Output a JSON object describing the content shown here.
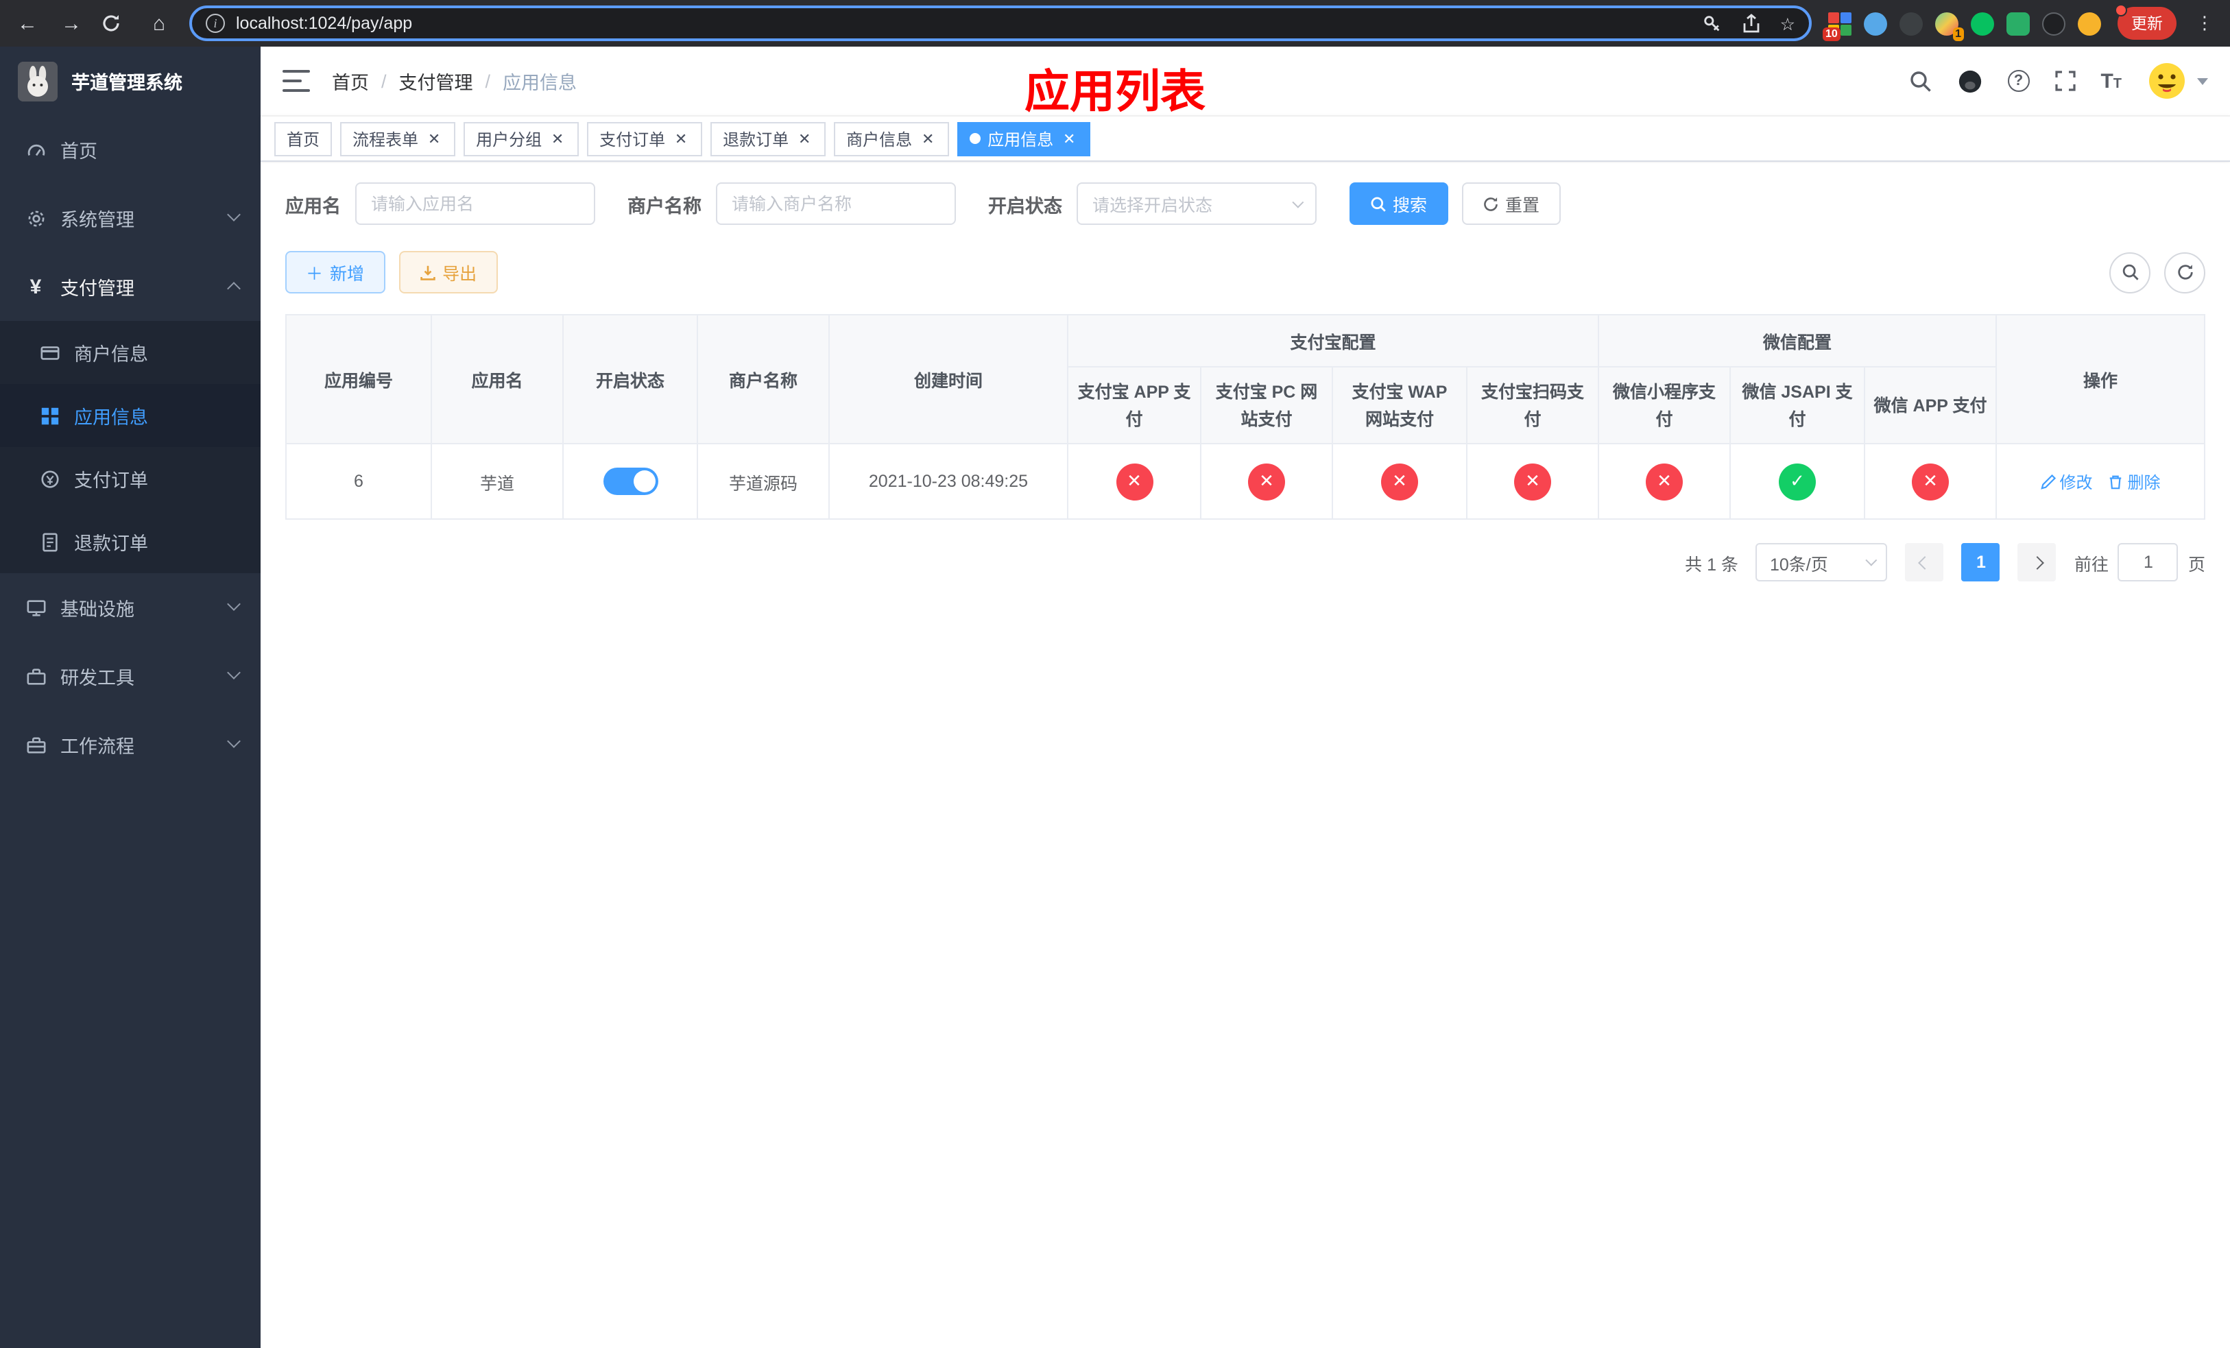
{
  "browser": {
    "url": "localhost:1024/pay/app",
    "update_label": "更新",
    "extension_badge": "10",
    "profile_badge": "1"
  },
  "sidebar": {
    "title": "芋道管理系统",
    "items": [
      {
        "label": "首页"
      },
      {
        "label": "系统管理"
      },
      {
        "label": "支付管理"
      },
      {
        "label": "基础设施"
      },
      {
        "label": "研发工具"
      },
      {
        "label": "工作流程"
      }
    ],
    "payment_submenu": [
      {
        "label": "商户信息"
      },
      {
        "label": "应用信息"
      },
      {
        "label": "支付订单"
      },
      {
        "label": "退款订单"
      }
    ]
  },
  "header": {
    "breadcrumb": [
      "首页",
      "支付管理",
      "应用信息"
    ],
    "annotation": "应用列表"
  },
  "tabs": [
    {
      "label": "首页"
    },
    {
      "label": "流程表单"
    },
    {
      "label": "用户分组"
    },
    {
      "label": "支付订单"
    },
    {
      "label": "退款订单"
    },
    {
      "label": "商户信息"
    },
    {
      "label": "应用信息"
    }
  ],
  "filters": {
    "app_name_label": "应用名",
    "app_name_placeholder": "请输入应用名",
    "merchant_label": "商户名称",
    "merchant_placeholder": "请输入商户名称",
    "status_label": "开启状态",
    "status_placeholder": "请选择开启状态",
    "search_label": "搜索",
    "reset_label": "重置"
  },
  "toolbar": {
    "add_label": "新增",
    "export_label": "导出"
  },
  "table": {
    "columns": {
      "id": "应用编号",
      "name": "应用名",
      "enabled": "开启状态",
      "merchant": "商户名称",
      "created": "创建时间",
      "alipay_group": "支付宝配置",
      "wechat_group": "微信配置",
      "alipay_app": "支付宝 APP 支付",
      "alipay_pc": "支付宝 PC 网站支付",
      "alipay_wap": "支付宝 WAP 网站支付",
      "alipay_qr": "支付宝扫码支付",
      "wx_mini": "微信小程序支付",
      "wx_jsapi": "微信 JSAPI 支付",
      "wx_app": "微信 APP 支付",
      "ops": "操作"
    },
    "rows": [
      {
        "id": "6",
        "name": "芋道",
        "enabled": "true",
        "merchant": "芋道源码",
        "created": "2021-10-23 08:49:25",
        "statuses": [
          "disabled",
          "disabled",
          "disabled",
          "disabled",
          "disabled",
          "enabled",
          "disabled"
        ],
        "edit_label": "修改",
        "delete_label": "删除"
      }
    ]
  },
  "pagination": {
    "total": "共 1 条",
    "per_page": "10条/页",
    "page": "1",
    "goto_prefix": "前往",
    "goto_value": "1",
    "goto_suffix": "页"
  },
  "colors": {
    "primary": "#409eff",
    "danger": "#f8444f",
    "success": "#13ce66",
    "sidebar_bg": "#28303f",
    "update_pill": "#d93a32"
  }
}
